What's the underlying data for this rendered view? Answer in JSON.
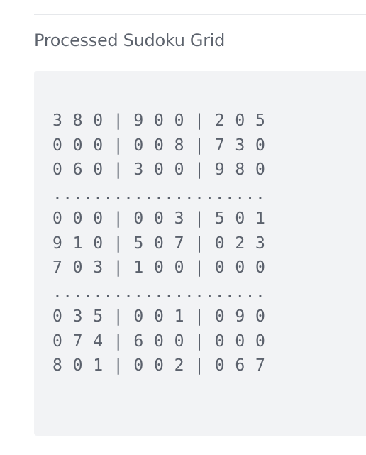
{
  "title": "Processed Sudoku Grid",
  "grid_lines": [
    "3 8 0 | 9 0 0 | 2 0 5",
    "0 0 0 | 0 0 8 | 7 3 0",
    "0 6 0 | 3 0 0 | 9 8 0",
    ".....................",
    "0 0 0 | 0 0 3 | 5 0 1",
    "9 1 0 | 5 0 7 | 0 2 3",
    "7 0 3 | 1 0 0 | 0 0 0",
    ".....................",
    "0 3 5 | 0 0 1 | 0 9 0",
    "0 7 4 | 6 0 0 | 0 0 0",
    "8 0 1 | 0 0 2 | 0 6 7"
  ]
}
